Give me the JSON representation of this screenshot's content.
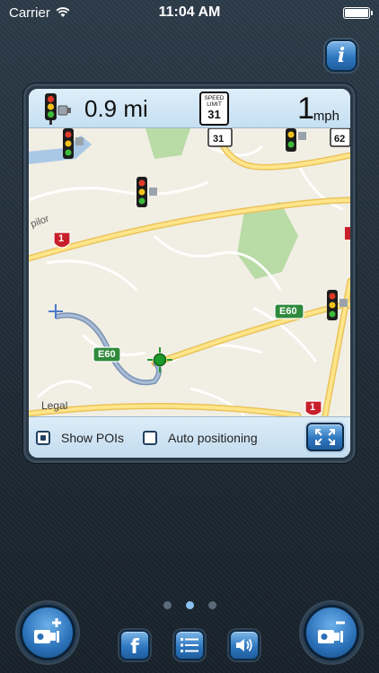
{
  "status_bar": {
    "carrier": "Carrier",
    "time": "11:04 AM",
    "battery_level": 1.0
  },
  "info_button": {
    "label": "i",
    "icon": "info-icon"
  },
  "top_bar": {
    "distance": "0.9 mi",
    "speed_limit_label_1": "SPEED",
    "speed_limit_label_2": "LIMIT",
    "speed_limit_value": "31",
    "speed": "1",
    "speed_unit": "mph"
  },
  "map": {
    "legal_label": "Legal",
    "road_labels": [
      "E60",
      "E60"
    ],
    "route_shield": "1",
    "speed_signs": [
      "31",
      "62"
    ],
    "place_fragment": "pilor"
  },
  "bottom_bar": {
    "show_pois_label": "Show POIs",
    "show_pois_checked": true,
    "auto_positioning_label": "Auto positioning",
    "auto_positioning_checked": false
  },
  "pagination": {
    "pages": 3,
    "active": 2
  },
  "toolbar": {
    "add_camera_icon": "add-camera-icon",
    "facebook_label": "f",
    "list_icon": "list-icon",
    "sound_icon": "speaker-icon",
    "camera_list_icon": "camera-list-icon"
  },
  "colors": {
    "accent": "#2f78c0",
    "background": "#1f2b36",
    "road_label_green": "#2f8a3c",
    "route_shield_red": "#c8202a"
  }
}
